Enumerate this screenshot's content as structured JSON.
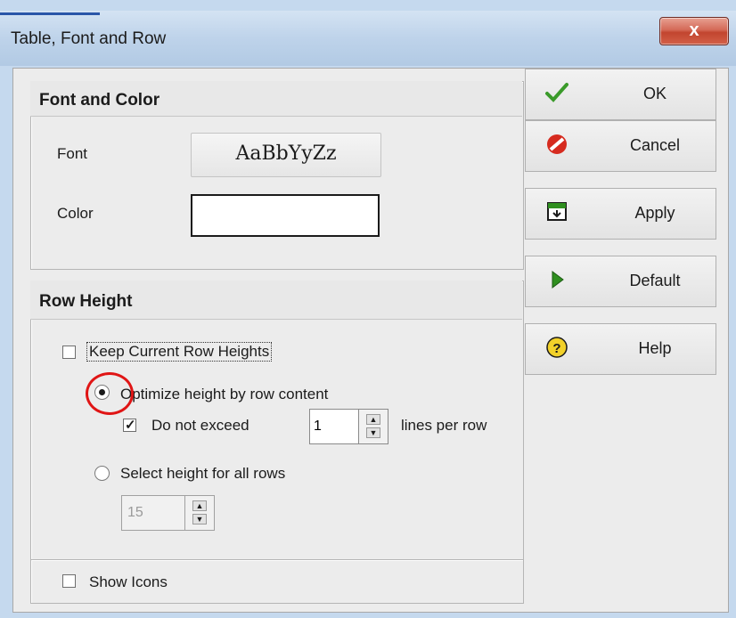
{
  "window": {
    "title": "Table, Font and Row",
    "close_label": "x"
  },
  "font_color": {
    "header": "Font and Color",
    "font_label": "Font",
    "font_preview": "AaBbYyZz",
    "color_label": "Color",
    "color_value": "#ffffff"
  },
  "row_height": {
    "header": "Row Height",
    "keep_current": {
      "label": "Keep Current Row Heights",
      "checked": false
    },
    "optimize": {
      "label": "Optimize height by row content",
      "selected": true
    },
    "do_not_exceed": {
      "label": "Do not exceed",
      "checked": true
    },
    "lines_value": "1",
    "lines_suffix": "lines per row",
    "select_height": {
      "label": "Select height for all rows",
      "selected": false
    },
    "height_value": "15"
  },
  "show_icons": {
    "label": "Show Icons",
    "checked": false
  },
  "buttons": {
    "ok": "OK",
    "cancel": "Cancel",
    "apply": "Apply",
    "default": "Default",
    "help": "Help"
  },
  "colors": {
    "ok_icon": "#3a9a2a",
    "cancel_icon": "#d62b1f",
    "default_icon": "#2f8f1f",
    "help_icon": "#f2d12a",
    "annotation_circle": "#e01515"
  }
}
